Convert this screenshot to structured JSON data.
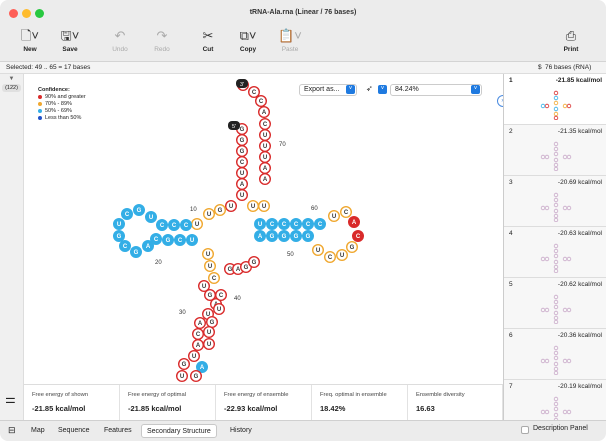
{
  "window": {
    "title": "tRNA-Ala.rna  (Linear / 76 bases)"
  },
  "toolbar": {
    "new": "New",
    "save": "Save",
    "undo": "Undo",
    "redo": "Redo",
    "cut": "Cut",
    "copy": "Copy",
    "paste": "Paste",
    "print": "Print"
  },
  "selection": {
    "text": "Selected:  49 .. 65  =  17 bases",
    "summary": "76 bases  (RNA)",
    "sum_icon": "$"
  },
  "left": {
    "counter": "(122)"
  },
  "legend": {
    "title": "Confidence:",
    "items": [
      {
        "label": "90% and greater",
        "color": "#d92b2b"
      },
      {
        "label": "70% - 89%",
        "color": "#f0a830"
      },
      {
        "label": "50% - 69%",
        "color": "#33aee6"
      },
      {
        "label": "Less than 50%",
        "color": "#2050c8"
      }
    ]
  },
  "controls": {
    "export": "Export as...",
    "zoom": "84.24%"
  },
  "structures": [
    {
      "n": "1",
      "e": "-21.85 kcal/mol"
    },
    {
      "n": "2",
      "e": "-21.35 kcal/mol"
    },
    {
      "n": "3",
      "e": "-20.69 kcal/mol"
    },
    {
      "n": "4",
      "e": "-20.63 kcal/mol"
    },
    {
      "n": "5",
      "e": "-20.62 kcal/mol"
    },
    {
      "n": "6",
      "e": "-20.36 kcal/mol"
    },
    {
      "n": "7",
      "e": "-20.19 kcal/mol"
    }
  ],
  "stats": [
    {
      "t": "Free energy of shown",
      "v": "-21.85 kcal/mol"
    },
    {
      "t": "Free energy of optimal",
      "v": "-21.85 kcal/mol"
    },
    {
      "t": "Free energy of ensemble",
      "v": "-22.93 kcal/mol"
    },
    {
      "t": "Freq. optimal in ensemble",
      "v": "18.42%"
    },
    {
      "t": "Ensemble diversity",
      "v": "16.63"
    }
  ],
  "tabs": [
    "Map",
    "Sequence",
    "Features",
    "Secondary Structure",
    "History"
  ],
  "description_panel": "Description Panel",
  "ticks": [
    "10",
    "20",
    "30",
    "40",
    "50",
    "60",
    "70"
  ],
  "markers": [
    "3'",
    "5'"
  ]
}
